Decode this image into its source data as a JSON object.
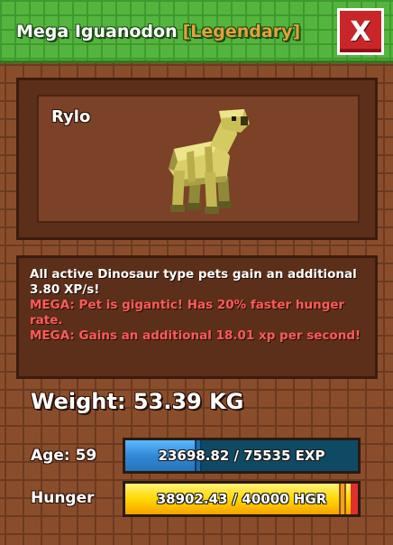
{
  "header": {
    "title": "Mega Iguanodon",
    "rarity": "[Legendary]",
    "close_label": "X"
  },
  "pet": {
    "name": "Rylo",
    "image_icon": "golden-iguanodon-icon"
  },
  "description": {
    "lines": [
      "All active Dinosaur type pets gain an additional 3.80 XP/s!",
      "MEGA: Pet is gigantic! Has 20% faster hunger rate.",
      "MEGA: Gains an additional 18.01 xp per second!"
    ]
  },
  "stats": {
    "weight": "Weight: 53.39 KG",
    "age_label": "Age: 59",
    "exp_text": "23698.82 / 75535 EXP",
    "exp_current": 23698.82,
    "exp_max": 75535,
    "hunger_label": "Hunger",
    "hgr_text": "38902.43 / 40000 HGR",
    "hgr_current": 38902.43,
    "hgr_max": 40000
  },
  "colors": {
    "header_green": "#54b53e",
    "rarity_orange": "#e0a33a",
    "close_red": "#c9262a",
    "mega_red": "#ff5a5a",
    "exp_blue": "#2f86d4",
    "hunger_yellow": "#ffd800"
  }
}
